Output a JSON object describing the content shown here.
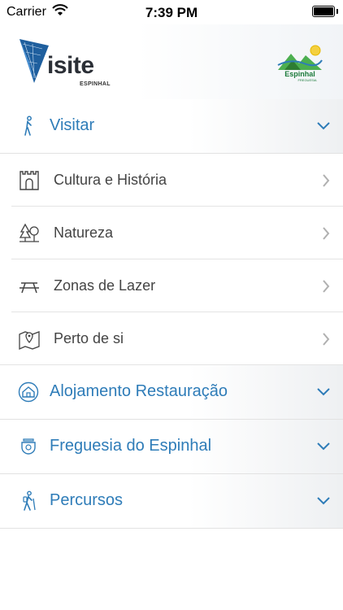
{
  "status_bar": {
    "carrier": "Carrier",
    "time": "7:39 PM",
    "battery_level": 1.0
  },
  "header": {
    "logo_text": "isite",
    "logo_subtext": "ESPINHAL",
    "partner_logo_text": "Espinhal",
    "partner_logo_subtext": "FREGUESIA"
  },
  "colors": {
    "accent": "#2e7cb8",
    "sub_text": "#444444",
    "chevron_grey": "#b0b0b0"
  },
  "menu": {
    "visitar": {
      "label": "Visitar",
      "icon": "walking-person-icon",
      "expanded": true,
      "items": [
        {
          "label": "Cultura e História",
          "icon": "castle-gate-icon"
        },
        {
          "label": "Natureza",
          "icon": "trees-icon"
        },
        {
          "label": "Zonas de Lazer",
          "icon": "picnic-table-icon"
        },
        {
          "label": "Perto de si",
          "icon": "map-pin-icon"
        }
      ]
    },
    "alojamento": {
      "label": "Alojamento Restauração",
      "icon": "house-icon"
    },
    "freguesia": {
      "label": "Freguesia do Espinhal",
      "icon": "coat-of-arms-icon"
    },
    "percursos": {
      "label": "Percursos",
      "icon": "hiker-icon"
    }
  }
}
